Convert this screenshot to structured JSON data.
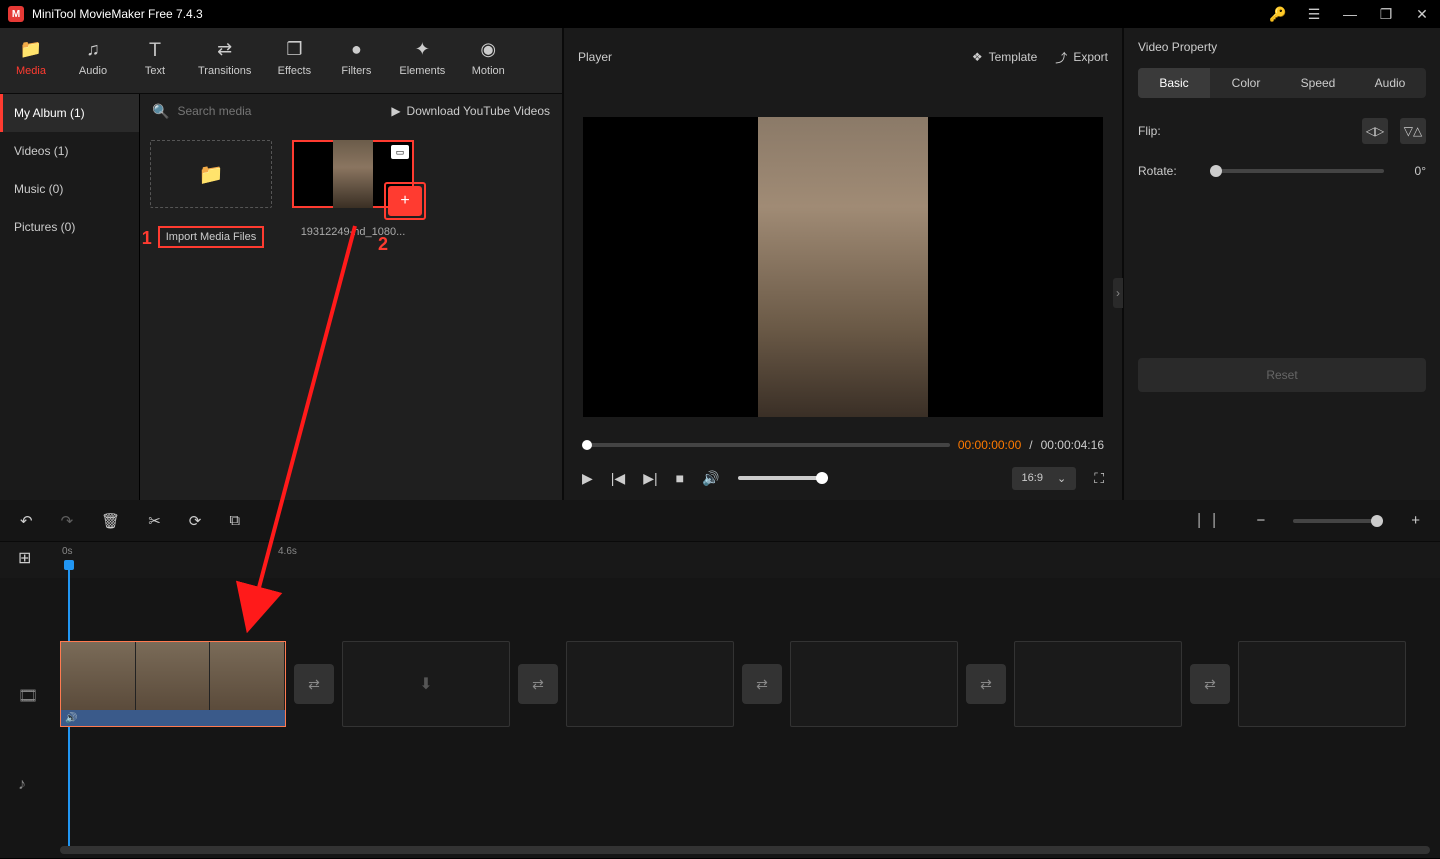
{
  "app": {
    "title": "MiniTool MovieMaker Free 7.4.3"
  },
  "tabs": {
    "media": "Media",
    "audio": "Audio",
    "text": "Text",
    "transitions": "Transitions",
    "effects": "Effects",
    "filters": "Filters",
    "elements": "Elements",
    "motion": "Motion"
  },
  "sidebar": {
    "album": "My Album (1)",
    "videos": "Videos (1)",
    "music": "Music (0)",
    "pictures": "Pictures (0)"
  },
  "media": {
    "search_placeholder": "Search media",
    "download_link": "Download YouTube Videos",
    "import_label": "Import Media Files",
    "clip_name": "19312249-hd_1080...",
    "anno1": "1",
    "anno2": "2"
  },
  "player": {
    "title": "Player",
    "template": "Template",
    "export": "Export",
    "current": "00:00:00:00",
    "sep": " / ",
    "duration": "00:00:04:16",
    "aspect": "16:9"
  },
  "props": {
    "title": "Video Property",
    "tab_basic": "Basic",
    "tab_color": "Color",
    "tab_speed": "Speed",
    "tab_audio": "Audio",
    "flip_label": "Flip:",
    "rotate_label": "Rotate:",
    "rotate_value": "0°",
    "reset": "Reset"
  },
  "timeline": {
    "t0": "0s",
    "t1": "4.6s"
  }
}
